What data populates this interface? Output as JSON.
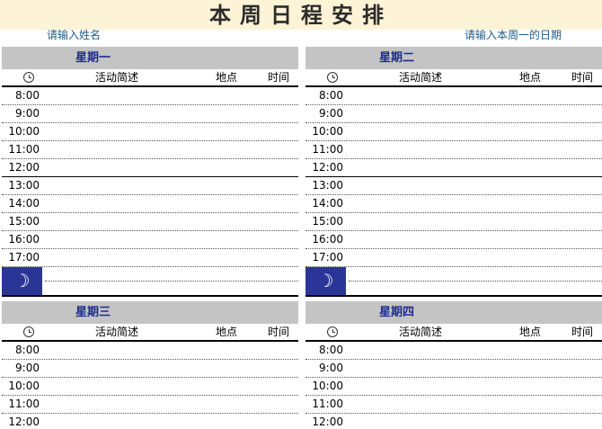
{
  "title": "本周日程安排",
  "name_placeholder": "请输入姓名",
  "date_placeholder": "请输入本周一的日期",
  "columns": {
    "activity": "活动简述",
    "location": "地点",
    "time": "时间"
  },
  "evening_icon": "moon-icon",
  "moon_glyph": "☽",
  "days": [
    {
      "name": "星期一",
      "slots": [
        "8:00",
        "9:00",
        "10:00",
        "11:00",
        "12:00",
        "13:00",
        "14:00",
        "15:00",
        "16:00",
        "17:00"
      ]
    },
    {
      "name": "星期二",
      "slots": [
        "8:00",
        "9:00",
        "10:00",
        "11:00",
        "12:00",
        "13:00",
        "14:00",
        "15:00",
        "16:00",
        "17:00"
      ]
    },
    {
      "name": "星期三",
      "slots": [
        "8:00",
        "9:00",
        "10:00",
        "11:00",
        "12:00"
      ]
    },
    {
      "name": "星期四",
      "slots": [
        "8:00",
        "9:00",
        "10:00",
        "11:00",
        "12:00"
      ]
    }
  ],
  "colors": {
    "title_bg": "#fdf3d6",
    "day_header_bg": "#c4c4c4",
    "day_header_text": "#1c2a8c",
    "evening_bg": "#2b3598",
    "placeholder_text": "#1f5c8a"
  }
}
